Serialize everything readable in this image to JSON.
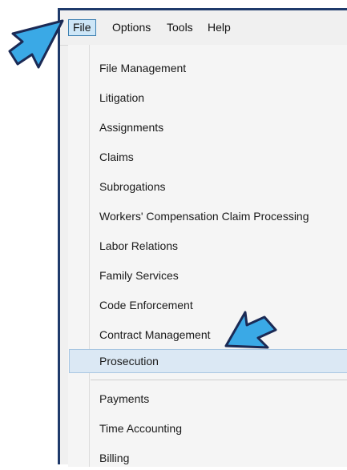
{
  "menubar": {
    "items": [
      {
        "label": "File",
        "active": true
      },
      {
        "label": "Options",
        "active": false
      },
      {
        "label": "Tools",
        "active": false
      },
      {
        "label": "Help",
        "active": false
      }
    ]
  },
  "file_menu": {
    "items": [
      {
        "label": "File Management"
      },
      {
        "label": "Litigation"
      },
      {
        "label": "Assignments"
      },
      {
        "label": "Claims"
      },
      {
        "label": "Subrogations"
      },
      {
        "label": "Workers' Compensation Claim Processing"
      },
      {
        "label": "Labor Relations"
      },
      {
        "label": "Family Services"
      },
      {
        "label": "Code Enforcement"
      },
      {
        "label": "Contract Management"
      },
      {
        "label": "Prosecution",
        "highlighted": true
      },
      {
        "label": "Payments"
      },
      {
        "label": "Time Accounting"
      },
      {
        "label": "Billing"
      }
    ]
  },
  "annotations": {
    "arrow_fill": "#3aa9e6",
    "arrow_stroke": "#1b2a55",
    "icons": [
      "arrow-pointer-icon",
      "arrow-pointer-icon"
    ]
  },
  "colors": {
    "window_border": "#1f3a6b",
    "active_menu_bg": "#cde6f7",
    "highlight_bg": "#dbe8f4"
  }
}
